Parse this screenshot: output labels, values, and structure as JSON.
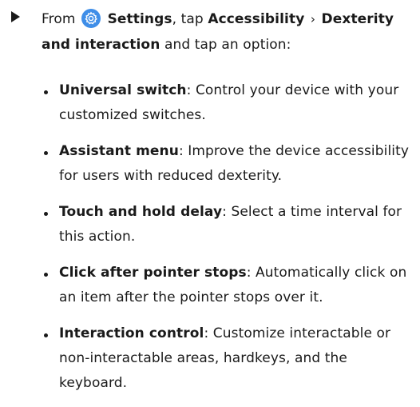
{
  "instruction": {
    "from": "From",
    "settings": "Settings",
    "tap": ", tap",
    "accessibility": "Accessibility",
    "chevron": "›",
    "dexterity": "Dexterity and interaction",
    "tail": "and tap an option:"
  },
  "options": [
    {
      "title": "Universal switch",
      "desc": ": Control your device with your customized switches."
    },
    {
      "title": "Assistant menu",
      "desc": ": Improve the device accessibility for users with reduced dexterity."
    },
    {
      "title": "Touch and hold delay",
      "desc": ": Select a time interval for this action."
    },
    {
      "title": "Click after pointer stops",
      "desc": ": Automatically click on an item after the pointer stops over it."
    },
    {
      "title": "Interaction control",
      "desc": ": Customize interactable or non-interactable areas, hardkeys, and the keyboard."
    }
  ],
  "icons": {
    "step": "arrow-right-icon",
    "settings": "gear-icon",
    "settings_color": "#3f8ee8"
  }
}
